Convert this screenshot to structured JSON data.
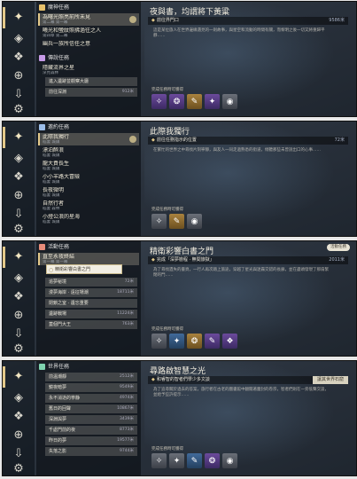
{
  "panels": [
    {
      "list": {
        "rows": [
          {
            "kind": "cat",
            "label": "魔神任務",
            "color": "#e7c16b"
          },
          {
            "kind": "row",
            "title": "為曙光照亮前所未見",
            "sub": "第二幕 第一幕",
            "state": "sel"
          },
          {
            "kind": "row",
            "title": "曦光和螢紋照拂過往之人",
            "sub": "第四章 第二幕",
            "state": ""
          },
          {
            "kind": "row",
            "title": "幽兵一族所信任之意",
            "sub": "",
            "state": ""
          },
          {
            "kind": "cat",
            "label": "傳說任務",
            "color": "#c79be8"
          },
          {
            "kind": "row",
            "title": "隱藏流界之星",
            "sub": "深見森林",
            "state": ""
          },
          {
            "kind": "sub",
            "label": "進入遺跡並觀察大廳",
            "num": ""
          },
          {
            "kind": "sub",
            "label": "前往深淵",
            "num": "912米"
          }
        ]
      },
      "detail": {
        "title": "夜與書，均謂將下黃粱",
        "goal": "前往界門口",
        "distance": "9586米",
        "desc": "這是某位旅人在世界邊緣遇見的一則故事，與星空和流動的時間有關，而黎明之後一切又將重歸平靜……",
        "reward_label": "完成任務時可獲得",
        "rewards": [
          "purple",
          "purple",
          "gold",
          "purple",
          "gray"
        ]
      }
    },
    {
      "list": {
        "rows": [
          {
            "kind": "cat",
            "label": "邀約任務",
            "color": "#9bbde8"
          },
          {
            "kind": "row",
            "title": "此際我獨行",
            "sub": "稻妻 城鎮",
            "state": "sel"
          },
          {
            "kind": "row",
            "title": "漂泊醉浪",
            "sub": "稻妻 城鎮",
            "state": ""
          },
          {
            "kind": "row",
            "title": "龍大貢長生",
            "sub": "稻妻 城鎮",
            "state": ""
          },
          {
            "kind": "row",
            "title": "小小羊路大冒險",
            "sub": "稻妻 城鎮",
            "state": ""
          },
          {
            "kind": "row",
            "title": "長夜微明",
            "sub": "稻妻 城鎮",
            "state": ""
          },
          {
            "kind": "row",
            "title": "自然行者",
            "sub": "稻妻 森林",
            "state": ""
          },
          {
            "kind": "row",
            "title": "小燈公浪的星海",
            "sub": "稻妻 城鎮",
            "state": ""
          }
        ]
      },
      "detail": {
        "title": "此際我獨行",
        "goal": "前往任務指示的位置",
        "distance": "72米",
        "desc": "在繁忙的世界之中尋找片刻寧靜，與友人一同走過熟悉的街道，傾聽那些未曾說出口的心事……",
        "reward_label": "完成任務時可獲得",
        "rewards": [
          "gray",
          "gold",
          "gray"
        ]
      }
    },
    {
      "list": {
        "rows": [
          {
            "kind": "cat",
            "label": "活動任務",
            "color": "#e88c7a"
          },
          {
            "kind": "row",
            "title": "直至永夜終結",
            "sub": "第一幕 第一幕",
            "state": "sel"
          },
          {
            "kind": "sub",
            "label": "追夢秘境",
            "num": "72米"
          },
          {
            "kind": "sub",
            "label": "漫夢海岸 · 遠征場潮",
            "num": "18711米"
          },
          {
            "kind": "sub",
            "label": "閉鎖之室 · 遺忘重要",
            "num": ""
          },
          {
            "kind": "sub",
            "label": "遺跡戰場",
            "num": "11224米"
          },
          {
            "kind": "sub",
            "label": "蓋個門大王",
            "num": "763米"
          }
        ]
      },
      "popover": "精衛彩響白書之門",
      "detail": {
        "title": "精衛彩響白書之門",
        "goal": "完成「深夢戀程 · 無間旅獄」",
        "distance": "2011米",
        "tag": "活動任務",
        "desc": "為了尋找遺失的書頁，一行人再次踏上旅途，穿越了星光與迷霧交錯的長廊，並在盡頭發現了那扇緊閉的門……",
        "reward_label": "完成任務時可獲得",
        "rewards": [
          "gray",
          "blue",
          "gold",
          "purple",
          "purple"
        ]
      }
    },
    {
      "list": {
        "rows": [
          {
            "kind": "cat",
            "label": "世界任務",
            "color": "#7fd4b0"
          },
          {
            "kind": "sub",
            "label": "前溫潮靜",
            "num": "2512米"
          },
          {
            "kind": "sub",
            "label": "鏡夜暗夢",
            "num": "9549米"
          },
          {
            "kind": "sub",
            "label": "永不消逝的寧静",
            "num": "4974米"
          },
          {
            "kind": "sub",
            "label": "舊日的回聲",
            "num": "10867米"
          },
          {
            "kind": "sub",
            "label": "深淵與夢",
            "num": "3439米"
          },
          {
            "kind": "sub",
            "label": "千處門前的夜",
            "num": "8773米"
          },
          {
            "kind": "sub",
            "label": "昨日的夢",
            "num": "19577米"
          },
          {
            "kind": "sub",
            "label": "失落之影",
            "num": "9744米"
          }
        ]
      },
      "detail": {
        "title": "尋路啟智慧之光",
        "goal": "和睿智的智者們學少多文談",
        "distance": "",
        "tag": "讓其世界石窟",
        "desc": "為了追尋關於過去的答案，旅行者在古老的圖書館中翻閱著塵封的卷宗，智者們則在一旁低聲交談，並給予些許提示……",
        "reward_label": "完成任務時可獲得",
        "rewards": [
          "gray",
          "gray",
          "blue",
          "purple",
          "gray"
        ]
      }
    }
  ],
  "rail_icons": [
    "quest-icon",
    "compass-icon",
    "map-icon",
    "book-icon",
    "settings-icon",
    "gear-icon"
  ]
}
